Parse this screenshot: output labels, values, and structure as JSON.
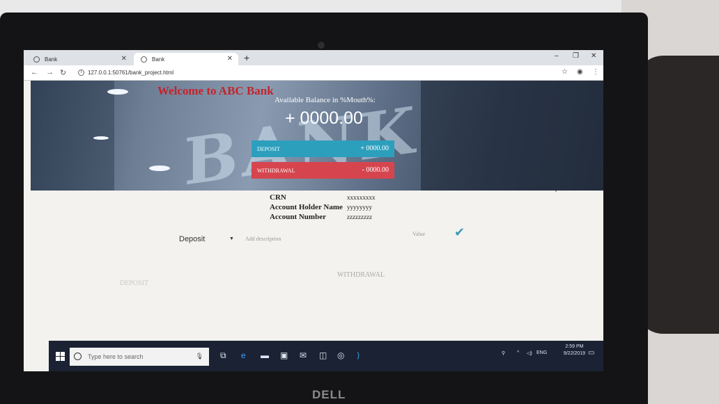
{
  "browser": {
    "tabs": [
      {
        "label": "Bank"
      },
      {
        "label": "Bank"
      }
    ],
    "new_tab": "+",
    "url": "127.0.0.1:50761/bank_project.html",
    "window_controls": [
      "–",
      "❐",
      "✕"
    ]
  },
  "hero": {
    "welcome": "Welcome to ABC Bank",
    "available_label": "Available Balance in %Mouth%:",
    "balance": "+ 0000.00",
    "deposit": {
      "label": "DEPOSIT",
      "amount": "+ 0000.00"
    },
    "withdrawal": {
      "label": "WITHDRAWAL",
      "amount": "- 0000.00"
    }
  },
  "account": {
    "crn_label": "CRN",
    "crn_value": "xxxxxxxxx",
    "holder_label": "Account Holder Name",
    "holder_value": "yyyyyyyy",
    "number_label": "Account Number",
    "number_value": "zzzzzzzzz"
  },
  "form": {
    "type_selected": "Deposit",
    "description_placeholder": "Add description",
    "value_placeholder": "Value"
  },
  "columns": {
    "deposit": "DEPOSIT",
    "withdrawal": "WITHDRAWAL"
  },
  "taskbar": {
    "search_placeholder": "Type here to search",
    "language": "ENG",
    "time": "2:59 PM",
    "date": "9/22/2019"
  },
  "device": {
    "brand": "DELL"
  },
  "colors": {
    "deposit": "#2c9fbd",
    "withdrawal": "#d6454e",
    "welcome": "#c4232b"
  }
}
